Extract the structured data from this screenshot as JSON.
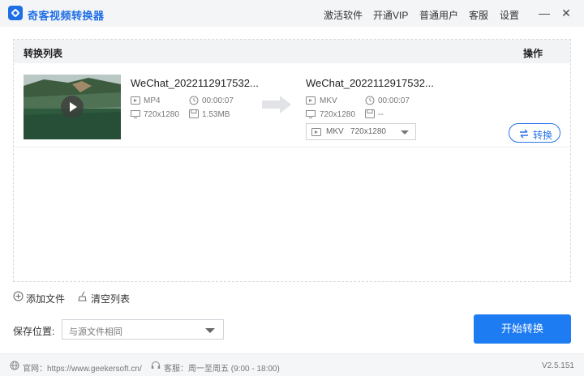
{
  "app": {
    "title": "奇客视频转换器"
  },
  "menu": {
    "activate": "激活软件",
    "vip": "开通VIP",
    "user": "普通用户",
    "service": "客服",
    "settings": "设置"
  },
  "list": {
    "title": "转换列表",
    "ops": "操作"
  },
  "file": {
    "source": {
      "name": "WeChat_2022112917532...",
      "format": "MP4",
      "duration": "00:00:07",
      "resolution": "720x1280",
      "size": "1.53MB"
    },
    "target": {
      "name": "WeChat_2022112917532...",
      "format": "MKV",
      "duration": "00:00:07",
      "resolution": "720x1280",
      "size": "--"
    },
    "output_select": {
      "format": "MKV",
      "resolution": "720x1280"
    },
    "convert_label": "转换"
  },
  "toolbar": {
    "add_file": "添加文件",
    "clear_list": "清空列表"
  },
  "save": {
    "label": "保存位置:",
    "value": "与源文件相同"
  },
  "start_label": "开始转换",
  "footer": {
    "website": "官网：https://www.geekersoft.cn/",
    "service": "客服：周一至周五 (9:00 - 18:00)",
    "version": "V2.5.151"
  },
  "colors": {
    "accent": "#1e7cf2",
    "title": "#1e6ee6"
  }
}
